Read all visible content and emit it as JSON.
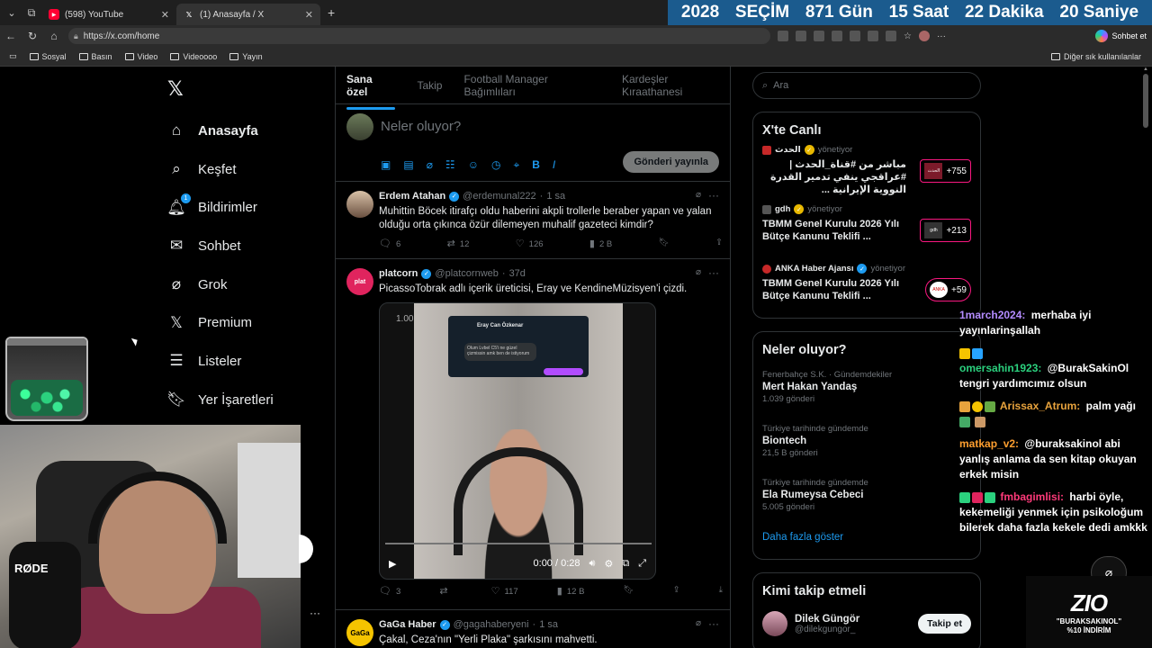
{
  "browser": {
    "tabs": [
      {
        "label": "(598) YouTube",
        "icon": "youtube-icon",
        "active": false
      },
      {
        "label": "(1) Anasayfa / X",
        "icon": "x-logo-icon",
        "active": true
      }
    ],
    "url": "https://x.com/home",
    "chat_label": "Sohbet et",
    "bookmarks": [
      "Sosyal",
      "Basın",
      "Video",
      "Videoooo",
      "Yayın"
    ],
    "other_bookmarks": "Diğer sık kullanılanlar"
  },
  "countdown": {
    "year": "2028",
    "label": "SEÇİM",
    "days": "871 Gün",
    "hours": "15 Saat",
    "minutes": "22 Dakika",
    "seconds": "20 Saniye",
    "bg_color": "#1b5b8e"
  },
  "nav": {
    "items": [
      {
        "label": "Anasayfa",
        "icon": "home-icon"
      },
      {
        "label": "Keşfet",
        "icon": "search-icon"
      },
      {
        "label": "Bildirimler",
        "icon": "bell-icon",
        "badge": "1"
      },
      {
        "label": "Sohbet",
        "icon": "mail-icon"
      },
      {
        "label": "Grok",
        "icon": "grok-icon"
      },
      {
        "label": "Premium",
        "icon": "x-logo-icon"
      },
      {
        "label": "Listeler",
        "icon": "list-icon"
      },
      {
        "label": "Yer İşaretleri",
        "icon": "bookmark-icon"
      }
    ]
  },
  "feed": {
    "tabs": [
      "Sana özel",
      "Takip",
      "Football Manager Bağımlıları",
      "Kardeşler Kıraathanesi"
    ],
    "composer": {
      "placeholder": "Neler oluyor?",
      "post_label": "Gönderi yayınla"
    },
    "tweets": [
      {
        "name": "Erdem Atahan",
        "handle": "@erdemunal222",
        "time": "1 sa",
        "text": "Muhittin Böcek itirafçı oldu haberini akpli trollerle beraber yapan ve yalan olduğu orta çıkınca özür dilemeyen muhalif gazeteci kimdir?",
        "replies": "6",
        "reposts": "12",
        "likes": "126",
        "views": "2 B"
      },
      {
        "name": "platcorn",
        "handle": "@platcornweb",
        "time": "37d",
        "text": "PicassoTobrak adlı içerik üreticisi, Eray ve KendineMüzisyen'i çizdi.",
        "video_time": "0:00 / 0:28",
        "video_chat_name": "Eray Can Özkenar",
        "video_chat_msg": "Olum Lvbel C5'i ne güzel çizmissin amk ben de istiyorum",
        "video_timecode": "1.00",
        "replies": "3",
        "reposts": "",
        "likes": "117",
        "views": "12 B"
      },
      {
        "name": "GaGa Haber",
        "handle": "@gagahaberyeni",
        "time": "1 sa",
        "text": "Çakal, Ceza'nın \"Yerli Plaka\" şarkısını mahvetti."
      }
    ]
  },
  "right": {
    "search_placeholder": "Ara",
    "live": {
      "title": "X'te Canlı",
      "items": [
        {
          "source": "الحدث",
          "role": "yönetiyor",
          "title": "مباشر من #قناة_الحدث | #عراقجي ينفي تدمير القدرة النووية الإيرانية ...",
          "count": "+755",
          "thumb": "الحدث"
        },
        {
          "source": "gdh",
          "role": "yönetiyor",
          "title": "TBMM Genel Kurulu 2026 Yılı Bütçe Kanunu Teklifi ...",
          "count": "+213",
          "thumb": "gdh"
        },
        {
          "source": "ANKA Haber Ajansı",
          "role": "yönetiyor",
          "title": "TBMM Genel Kurulu 2026 Yılı Bütçe Kanunu Teklifi ...",
          "count": "+59",
          "thumb": "ANKA"
        }
      ]
    },
    "trends": {
      "title": "Neler oluyor?",
      "items": [
        {
          "context": "Fenerbahçe S.K. · Gündemdekiler",
          "topic": "Mert Hakan Yandaş",
          "count": "1.039 gönderi"
        },
        {
          "context": "Türkiye tarihinde gündemde",
          "topic": "Biontech",
          "count": "21,5 B gönderi"
        },
        {
          "context": "Türkiye tarihinde gündemde",
          "topic": "Ela Rumeysa Cebeci",
          "count": "5.005 gönderi"
        }
      ],
      "show_more": "Daha fazla göster"
    },
    "who_to_follow": {
      "title": "Kimi takip etmeli",
      "name": "Dilek Güngör",
      "handle": "@dilekgungor_",
      "follow_label": "Takip et"
    }
  },
  "chat": {
    "messages": [
      {
        "user": "1march2024:",
        "text": "merhaba iyi yayınlarinşallah",
        "color": "#b48cff"
      },
      {
        "user": "omersahin1923:",
        "text": "@BurakSakinOl tengri yardımcımız olsun",
        "color": "#2bd17e"
      },
      {
        "user": "Arissax_Atrum:",
        "text": "palm yağı",
        "color": "#e8a33d"
      },
      {
        "user": "matkap_v2:",
        "text": "@buraksakinol abi yanlış anlama da sen kitap okuyan erkek misin",
        "color": "#ff9f2f"
      },
      {
        "user": "fmbagimlisi:",
        "text": "harbi öyle, kekemeliği yenmek için psikoloğum bilerek daha fazla kekele dedi amkkk",
        "color": "#ff3a7a"
      }
    ]
  },
  "overlay": {
    "mic_brand": "RØDE",
    "promo_logo": "ZIO",
    "promo_code": "\"BURAKSAKINOL\"",
    "promo_discount": "%10 İNDİRİM"
  }
}
